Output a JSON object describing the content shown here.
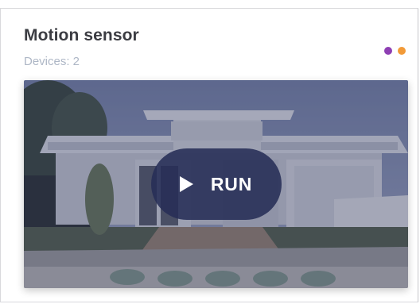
{
  "card": {
    "title": "Motion sensor",
    "subtitle": "Devices: 2",
    "indicators": [
      {
        "name": "status-dot-purple",
        "color": "#8e3fb3"
      },
      {
        "name": "status-dot-orange",
        "color": "#f29a38"
      }
    ]
  },
  "media": {
    "image_alt": "modern house exterior",
    "run_label": "RUN",
    "play_icon": "play-icon"
  }
}
